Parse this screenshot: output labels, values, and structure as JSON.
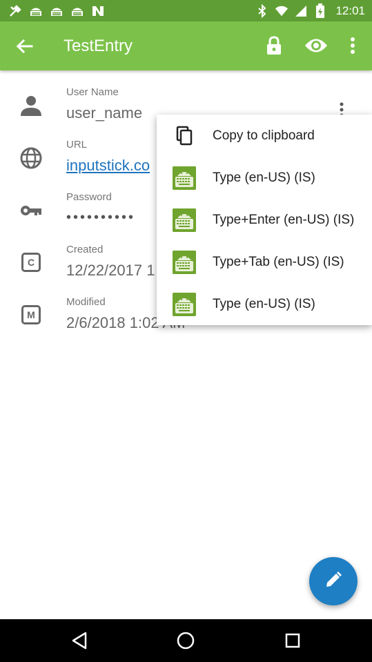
{
  "status_bar": {
    "time": "12:01"
  },
  "app_bar": {
    "title": "TestEntry"
  },
  "fields": [
    {
      "label": "User Name",
      "value": "user_name",
      "icon": "person-icon"
    },
    {
      "label": "URL",
      "value": "inputstick.co",
      "icon": "globe-icon"
    },
    {
      "label": "Password",
      "value": "••••••••••",
      "icon": "key-icon"
    },
    {
      "label": "Created",
      "value": "12/22/2017 1",
      "icon": "created-c-icon"
    },
    {
      "label": "Modified",
      "value": "2/6/2018 1:02 AM",
      "icon": "modified-m-icon"
    }
  ],
  "menu": {
    "items": [
      {
        "label": "Copy to clipboard",
        "icon": "copy-icon"
      },
      {
        "label": "Type (en-US) (IS)",
        "icon": "inputstick-keyboard-icon"
      },
      {
        "label": "Type+Enter (en-US) (IS)",
        "icon": "inputstick-keyboard-icon"
      },
      {
        "label": "Type+Tab (en-US) (IS)",
        "icon": "inputstick-keyboard-icon"
      },
      {
        "label": "Type (en-US) (IS)",
        "icon": "inputstick-keyboard-icon"
      }
    ]
  },
  "colors": {
    "status_bar": "#5f9e34",
    "app_bar": "#7cc24a",
    "fab": "#1e7fc4",
    "link": "#1e73be",
    "keyboard_icon": "#6fa42e"
  }
}
